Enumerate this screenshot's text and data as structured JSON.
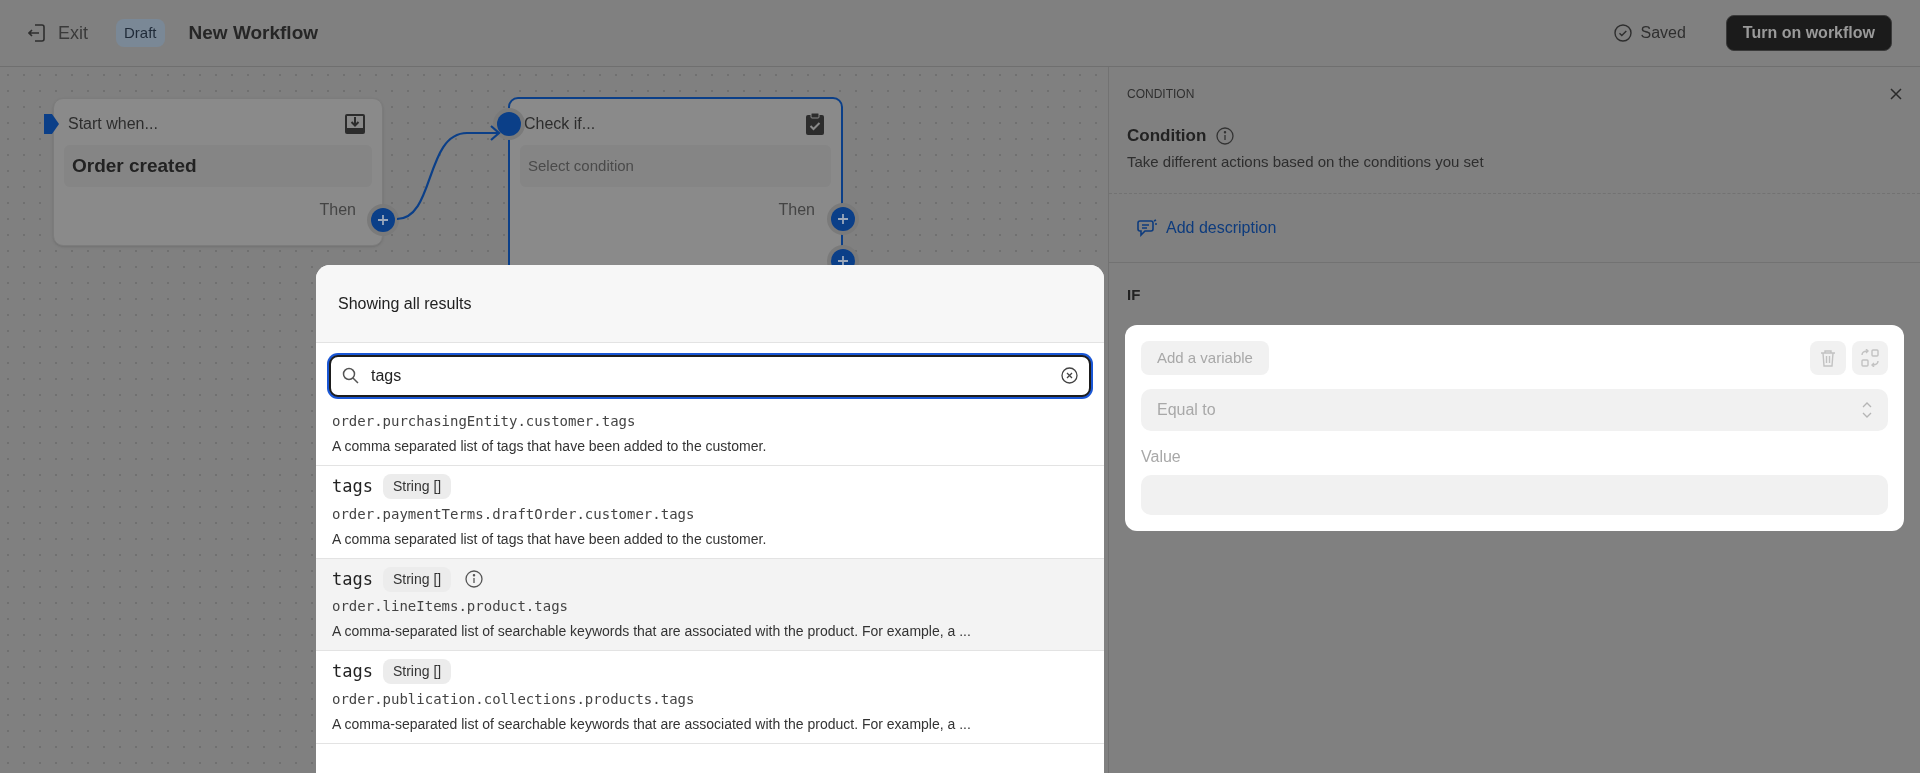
{
  "top_bar": {
    "exit": "Exit",
    "badge": "Draft",
    "title": "New Workflow",
    "status": "Saved",
    "primary_button": "Turn on workflow"
  },
  "canvas": {
    "nodes": [
      {
        "kind": "trigger",
        "header": "Start when...",
        "value": "Order created",
        "footer": "Then",
        "selected": false
      },
      {
        "kind": "condition",
        "header": "Check if...",
        "placeholder": "Select condition",
        "footer": "Then",
        "selected": true
      }
    ]
  },
  "picker": {
    "title": "Showing all results",
    "search": {
      "value": "tags"
    },
    "results": [
      {
        "path": "order.purchasingEntity.customer.tags",
        "description": "A comma separated list of tags that have been added to the customer.",
        "highlighted": false
      },
      {
        "name": "tags",
        "type": "String []",
        "path": "order.paymentTerms.draftOrder.customer.tags",
        "description": "A comma separated list of tags that have been added to the customer.",
        "highlighted": false
      },
      {
        "name": "tags",
        "type": "String []",
        "path": "order.lineItems.product.tags",
        "description": "A comma-separated list of searchable keywords that are associated with the product. For example, a ...",
        "highlighted": true
      },
      {
        "name": "tags",
        "type": "String []",
        "path": "order.publication.collections.products.tags",
        "description": "A comma-separated list of searchable keywords that are associated with the product. For example, a ...",
        "highlighted": false
      }
    ]
  },
  "panel": {
    "eyebrow": "CONDITION",
    "title": "Condition",
    "subtitle": "Take different actions based on the conditions you set",
    "add_description": "Add description",
    "section": "IF",
    "variable_button": "Add a variable",
    "operator": {
      "placeholder": "Equal to"
    },
    "value_field": {
      "label": "Value"
    }
  }
}
